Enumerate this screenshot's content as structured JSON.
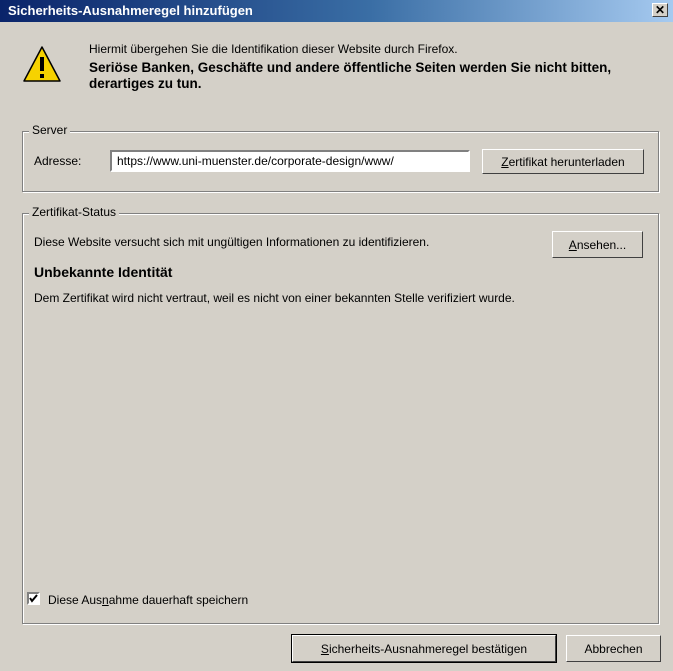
{
  "window": {
    "title": "Sicherheits-Ausnahmeregel hinzufügen",
    "close_glyph": "✕"
  },
  "intro": {
    "line1": "Hiermit übergehen Sie die Identifikation dieser Website durch Firefox.",
    "warning": "Seriöse Banken, Geschäfte und andere öffentliche Seiten werden Sie nicht bitten, derartiges zu tun.",
    "icon": "warning-icon"
  },
  "server": {
    "legend": "Server",
    "address_label": "Adresse:",
    "address_value": "https://www.uni-muenster.de/corporate-design/www/",
    "download_button": {
      "first": "Z",
      "rest": "ertifikat herunterladen"
    }
  },
  "status": {
    "legend": "Zertifikat-Status",
    "message": "Diese Website versucht sich mit ungültigen Informationen zu identifizieren.",
    "view_button": {
      "first": "A",
      "rest": "nsehen..."
    },
    "heading": "Unbekannte Identität",
    "detail": "Dem Zertifikat wird nicht vertraut, weil es nicht von einer bekannten Stelle verifiziert wurde."
  },
  "persist": {
    "checked": true,
    "label_before": "Diese Aus",
    "label_mnemonic": "n",
    "label_after": "ahme dauerhaft speichern"
  },
  "footer": {
    "confirm_button": {
      "first": "S",
      "rest": "icherheits-Ausnahmeregel bestätigen"
    },
    "cancel_button": "Abbrechen"
  },
  "colors": {
    "title_start": "#0a246a",
    "title_end": "#a6caf0",
    "dialog_bg": "#d4d0c8",
    "warning_yellow": "#f6d200"
  }
}
